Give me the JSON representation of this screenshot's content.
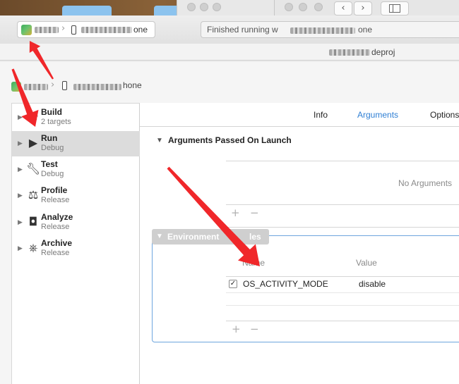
{
  "toolbar": {
    "scheme_suffix": "one",
    "status_text": "Finished running w",
    "status_suffix": "one",
    "nav_back_icon": "chevron-left-icon",
    "nav_forward_icon": "chevron-right-icon",
    "sidebar_toggle_icon": "sidebar-toggle-icon"
  },
  "pathbar": {
    "project_suffix": "deproj"
  },
  "editor": {
    "crumb_suffix": "hone",
    "actions": [
      {
        "title": "Build",
        "subtitle": "2 targets",
        "icon": "hammer-icon"
      },
      {
        "title": "Run",
        "subtitle": "Debug",
        "icon": "play-icon"
      },
      {
        "title": "Test",
        "subtitle": "Debug",
        "icon": "wrench-icon"
      },
      {
        "title": "Profile",
        "subtitle": "Release",
        "icon": "instruments-icon"
      },
      {
        "title": "Analyze",
        "subtitle": "Release",
        "icon": "analyze-icon"
      },
      {
        "title": "Archive",
        "subtitle": "Release",
        "icon": "archive-icon"
      }
    ],
    "selected_action": "Run",
    "tabs": [
      {
        "label": "Info",
        "active": false
      },
      {
        "label": "Arguments",
        "active": true
      },
      {
        "label": "Options",
        "active": false
      }
    ],
    "arguments": {
      "title": "Arguments Passed On Launch",
      "empty_text": "No Arguments",
      "add": "+",
      "remove": "−"
    },
    "environment": {
      "title_start": "Environment",
      "title_end": "les",
      "col_name": "Name",
      "col_value": "Value",
      "rows": [
        {
          "checked": "✓",
          "name": "OS_ACTIVITY_MODE",
          "value": "disable"
        }
      ],
      "add": "+",
      "remove": "−"
    }
  },
  "colors": {
    "accent": "#2f7fd4",
    "annotation_arrow": "#f0272a",
    "group_border": "#6da5de"
  }
}
